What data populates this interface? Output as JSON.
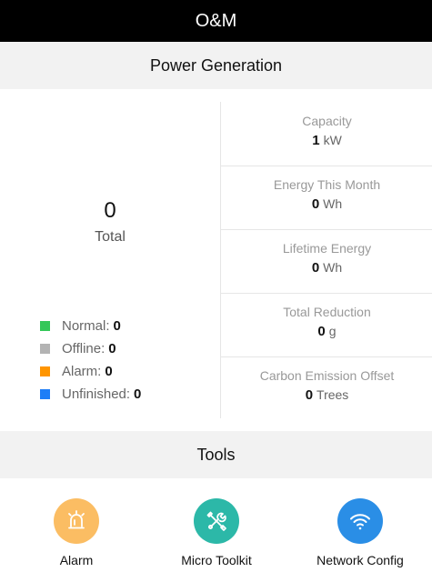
{
  "header": {
    "title": "O&M"
  },
  "power": {
    "title": "Power Generation",
    "total_value": "0",
    "total_label": "Total",
    "legend": [
      {
        "label": "Normal:",
        "value": "0",
        "color": "#34c759"
      },
      {
        "label": "Offline:",
        "value": "0",
        "color": "#b3b3b3"
      },
      {
        "label": "Alarm:",
        "value": "0",
        "color": "#ff9500"
      },
      {
        "label": "Unfinished:",
        "value": "0",
        "color": "#1e7ef7"
      }
    ],
    "metrics": [
      {
        "label": "Capacity",
        "value": "1",
        "unit": "kW"
      },
      {
        "label": "Energy This Month",
        "value": "0",
        "unit": "Wh"
      },
      {
        "label": "Lifetime Energy",
        "value": "0",
        "unit": "Wh"
      },
      {
        "label": "Total Reduction",
        "value": "0",
        "unit": "g"
      },
      {
        "label": "Carbon Emission Offset",
        "value": "0",
        "unit": "Trees"
      }
    ]
  },
  "tools": {
    "title": "Tools",
    "items": [
      {
        "label": "Alarm",
        "icon": "alarm-siren-icon",
        "color": "#fbbd63"
      },
      {
        "label": "Micro Toolkit",
        "icon": "toolkit-wrench-icon",
        "color": "#2cb8a8"
      },
      {
        "label": "Network Config",
        "icon": "wifi-icon",
        "color": "#2a8ee6"
      }
    ]
  }
}
